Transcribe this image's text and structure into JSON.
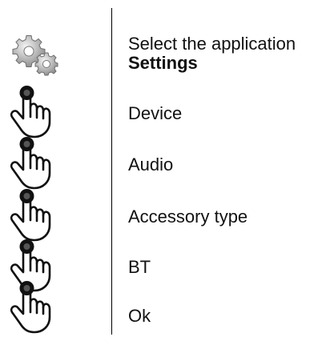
{
  "steps": [
    {
      "icon": "settings-gears-icon",
      "intro": "Select the application",
      "label": "Settings"
    },
    {
      "icon": "tap-hand-icon",
      "label": "Device"
    },
    {
      "icon": "tap-hand-icon",
      "label": "Audio"
    },
    {
      "icon": "tap-hand-icon",
      "label": "Accessory type"
    },
    {
      "icon": "tap-hand-icon",
      "label": "BT"
    },
    {
      "icon": "tap-hand-icon",
      "label": "Ok"
    }
  ]
}
